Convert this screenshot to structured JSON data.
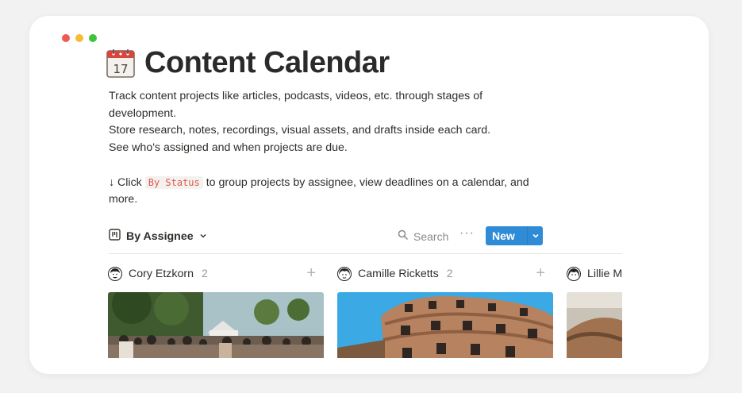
{
  "window_controls": [
    "close",
    "minimize",
    "maximize"
  ],
  "page": {
    "icon": "calendar-icon",
    "title": "Content Calendar",
    "description": {
      "line1": "Track content projects like articles, podcasts, videos, etc. through stages of development.",
      "line2": "Store research, notes, recordings, visual assets, and drafts inside each card.",
      "line3": "See who's assigned and when projects are due.",
      "hint_prefix": "↓ Click",
      "hint_code": "By Status",
      "hint_suffix": "to group projects by assignee, view deadlines on a calendar, and more."
    },
    "calendar_icon_number": "17"
  },
  "toolbar": {
    "view_label": "By Assignee",
    "search_label": "Search",
    "more_label": "···",
    "new_label": "New"
  },
  "board": {
    "columns": [
      {
        "name": "Cory Etzkorn",
        "count": "2"
      },
      {
        "name": "Camille Ricketts",
        "count": "2"
      },
      {
        "name": "Lillie Ma",
        "count": ""
      }
    ]
  },
  "colors": {
    "accent": "#2f8bd6",
    "code_text": "#e0584f"
  }
}
